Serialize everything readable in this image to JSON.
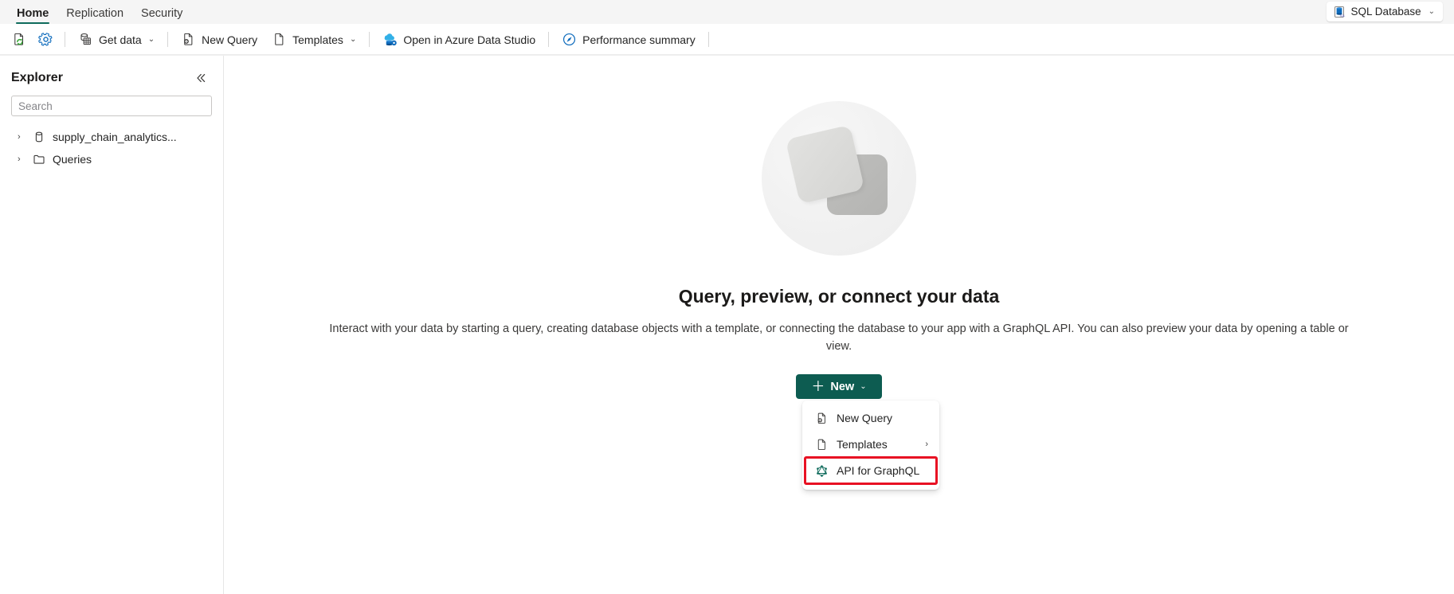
{
  "ribbon": {
    "tabs": [
      {
        "label": "Home",
        "active": true
      },
      {
        "label": "Replication",
        "active": false
      },
      {
        "label": "Security",
        "active": false
      }
    ],
    "database_badge": {
      "label": "SQL Database",
      "icon": "sql-database-icon",
      "chevron": "⌄"
    },
    "accent_color": "#0f6b5c"
  },
  "toolbar": {
    "refresh_label": "",
    "refresh_icon": "refresh-page-icon",
    "settings_icon": "gear-icon",
    "get_data": {
      "label": "Get data",
      "icon": "database-table-icon",
      "chevron": "⌄"
    },
    "new_query": {
      "label": "New Query",
      "icon": "new-query-icon"
    },
    "templates": {
      "label": "Templates",
      "icon": "document-icon",
      "chevron": "⌄"
    },
    "open_azure_data_studio": {
      "label": "Open in Azure Data Studio",
      "icon": "azure-data-studio-icon"
    },
    "performance_summary": {
      "label": "Performance summary",
      "icon": "gauge-icon"
    }
  },
  "explorer": {
    "title": "Explorer",
    "collapse_icon": "chevron-double-left-icon",
    "search": {
      "placeholder": "Search",
      "value": ""
    },
    "tree": [
      {
        "label": "supply_chain_analytics...",
        "icon": "database-icon",
        "chevron": "›",
        "expanded": false
      },
      {
        "label": "Queries",
        "icon": "folder-icon",
        "chevron": "›",
        "expanded": false
      }
    ]
  },
  "main": {
    "illustration": "two-stacked-squares-illustration",
    "title": "Query, preview, or connect your data",
    "description": "Interact with your data by starting a query, creating database objects with a template, or connecting the database to your app with a GraphQL API. You can also preview your data by opening a table or view.",
    "new_button": {
      "label": "New",
      "plus": "＋",
      "chevron": "⌄",
      "color": "#0d5c51"
    },
    "new_menu": [
      {
        "label": "New Query",
        "icon": "new-query-icon",
        "has_submenu": false,
        "highlighted": false
      },
      {
        "label": "Templates",
        "icon": "document-icon",
        "has_submenu": true,
        "submenu_chevron": "›",
        "highlighted": false
      },
      {
        "label": "API for GraphQL",
        "icon": "graphql-icon",
        "has_submenu": false,
        "highlighted": true
      }
    ],
    "highlight_color": "#e81123"
  }
}
